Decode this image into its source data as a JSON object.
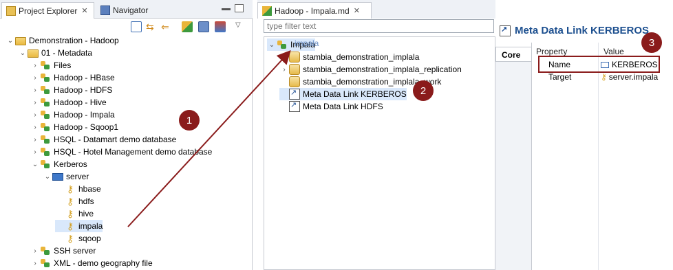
{
  "left_panel": {
    "tabs": [
      {
        "label": "Project Explorer",
        "close": "✕"
      },
      {
        "label": "Navigator"
      }
    ],
    "tree": [
      {
        "label": "Demonstration - Hadoop",
        "icon": "folder-open-icon",
        "level": 0,
        "chev": "⌄"
      },
      {
        "label": "01 - Metadata",
        "icon": "folder-open-icon",
        "level": 1,
        "chev": "⌄"
      },
      {
        "label": "Files",
        "icon": "hadoop-icon",
        "level": 2,
        "chev": "›"
      },
      {
        "label": "Hadoop - HBase",
        "icon": "hadoop-icon",
        "level": 2,
        "chev": "›"
      },
      {
        "label": "Hadoop - HDFS",
        "icon": "hadoop-icon",
        "level": 2,
        "chev": "›"
      },
      {
        "label": "Hadoop - Hive",
        "icon": "hadoop-icon",
        "level": 2,
        "chev": "›"
      },
      {
        "label": "Hadoop - Impala",
        "icon": "hadoop-icon",
        "level": 2,
        "chev": "›"
      },
      {
        "label": "Hadoop - Sqoop1",
        "icon": "hadoop-icon",
        "level": 2,
        "chev": "›"
      },
      {
        "label": "HSQL - Datamart demo database",
        "icon": "hadoop-icon",
        "level": 2,
        "chev": "›"
      },
      {
        "label": "HSQL - Hotel Management demo database",
        "icon": "hadoop-icon",
        "level": 2,
        "chev": "›"
      },
      {
        "label": "Kerberos",
        "icon": "hadoop-icon",
        "level": 2,
        "chev": "⌄"
      },
      {
        "label": "server",
        "icon": "server-icon",
        "level": 3,
        "chev": "⌄"
      },
      {
        "label": "hbase",
        "icon": "key-icon",
        "level": 4,
        "chev": ""
      },
      {
        "label": "hdfs",
        "icon": "key-icon",
        "level": 4,
        "chev": ""
      },
      {
        "label": "hive",
        "icon": "key-icon",
        "level": 4,
        "chev": ""
      },
      {
        "label": "impala",
        "icon": "key-icon",
        "level": 4,
        "chev": "",
        "selected": true
      },
      {
        "label": "sqoop",
        "icon": "key-icon",
        "level": 4,
        "chev": ""
      },
      {
        "label": "SSH server",
        "icon": "hadoop-icon",
        "level": 2,
        "chev": "›"
      },
      {
        "label": "XML - demo geography file",
        "icon": "hadoop-icon",
        "level": 2,
        "chev": "›"
      }
    ]
  },
  "editor": {
    "tab_label": "Hadoop - Impala.md",
    "tab_close": "✕",
    "filter_placeholder": "type filter text",
    "tree": [
      {
        "label": "Impala",
        "icon": "hadoop-icon",
        "level": 0,
        "chev": "⌄",
        "selected": true
      },
      {
        "label": "stambia_demonstration_implala",
        "icon": "database-icon",
        "level": 1,
        "chev": "›"
      },
      {
        "label": "stambia_demonstration_implala_replication",
        "icon": "database-icon",
        "level": 1,
        "chev": "›"
      },
      {
        "label": "stambia_demonstration_implala_work",
        "icon": "database-icon",
        "level": 1,
        "chev": ""
      },
      {
        "label": "Meta Data Link KERBEROS",
        "icon": "link-icon",
        "level": 1,
        "chev": "",
        "selected": true
      },
      {
        "label": "Meta Data Link HDFS",
        "icon": "link-icon",
        "level": 1,
        "chev": ""
      }
    ],
    "drag_label": "impala"
  },
  "properties": {
    "title": "Meta Data Link KERBEROS",
    "side_tab": "Core",
    "headers": [
      "Property",
      "Value"
    ],
    "rows": [
      {
        "property": "Name",
        "value": "KERBEROS"
      },
      {
        "property": "Target",
        "value": "server.impala"
      }
    ]
  },
  "callouts": [
    "1",
    "2",
    "3"
  ],
  "colors": {
    "callout": "#8a1b1b",
    "title": "#1c4f8f",
    "selection": "#d9e8fb"
  }
}
